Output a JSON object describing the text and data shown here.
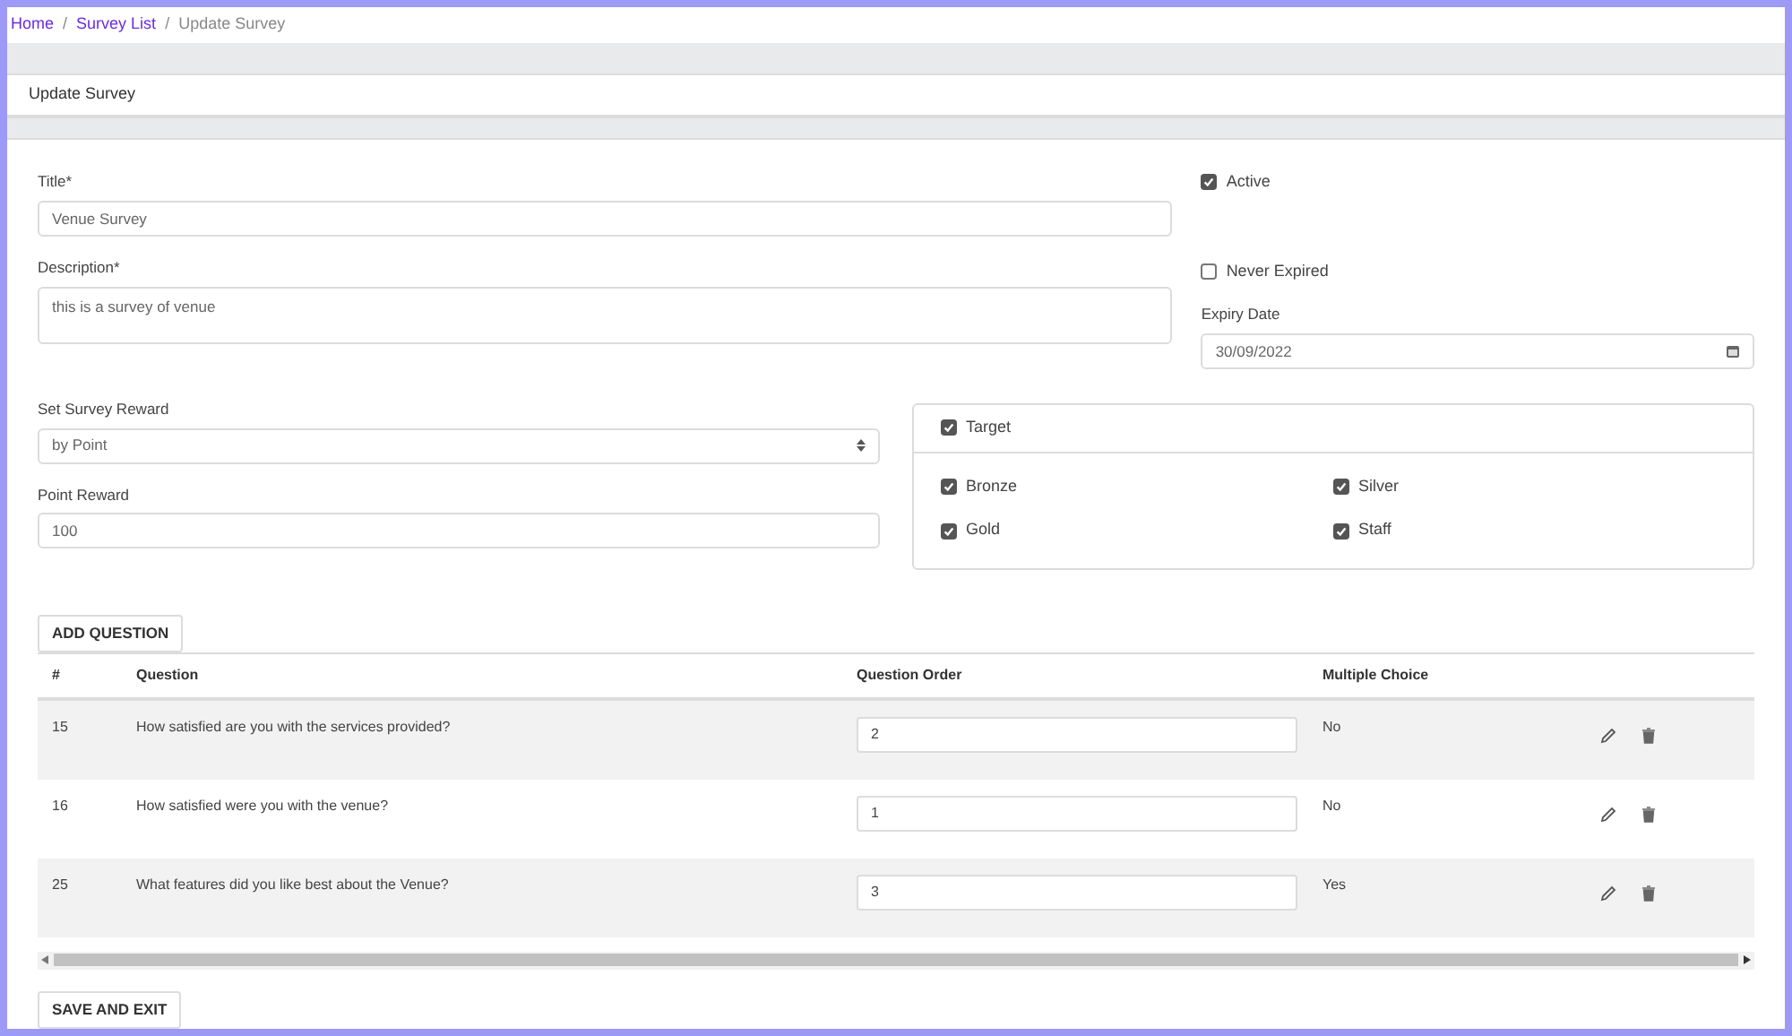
{
  "breadcrumb": [
    {
      "label": "Home",
      "link": true
    },
    {
      "separator": "/",
      "label": "Survey List",
      "link": true
    },
    {
      "separator": "/",
      "label": "Update Survey",
      "link": false
    }
  ],
  "card_title": "Update Survey",
  "form": {
    "title": {
      "label": "Title*",
      "value": "Venue Survey"
    },
    "description": {
      "label": "Description*",
      "value": "this is a survey of venue"
    },
    "reward_type": {
      "label": "Set Survey Reward",
      "value": "by Point"
    },
    "point_reward": {
      "label": "Point Reward",
      "value": "100"
    },
    "active": {
      "label": "Active",
      "checked": true
    },
    "never_expired": {
      "label": "Never Expired",
      "checked": false
    },
    "expiry_date": {
      "label": "Expiry Date",
      "value": "30/09/2022"
    }
  },
  "target": {
    "label": "Target",
    "checked": true,
    "options": [
      {
        "label": "Bronze",
        "checked": true
      },
      {
        "label": "Silver",
        "checked": true
      },
      {
        "label": "Gold",
        "checked": true
      },
      {
        "label": "Staff",
        "checked": true
      }
    ]
  },
  "add_question_button": "ADD QUESTION",
  "table": {
    "columns": [
      "#",
      "Question",
      "Question Order",
      "Multiple Choice"
    ],
    "rows": [
      {
        "id": "15",
        "question": "How satisfied are you with the services provided?",
        "order": "2",
        "multiple_choice": "No"
      },
      {
        "id": "16",
        "question": "How satisfied were you with the venue?",
        "order": "1",
        "multiple_choice": "No"
      },
      {
        "id": "25",
        "question": "What features did you like best about the Venue?",
        "order": "3",
        "multiple_choice": "Yes"
      }
    ]
  },
  "save_button": "SAVE AND EXIT"
}
